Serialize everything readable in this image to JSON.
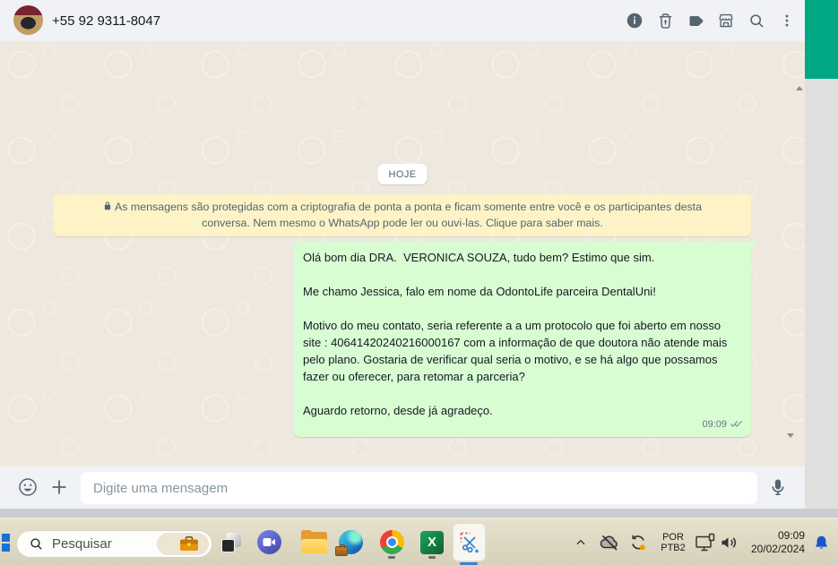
{
  "header": {
    "phone": "+55 92 9311-8047",
    "action_icons": [
      "info",
      "delete",
      "label",
      "storefront",
      "search",
      "more-options"
    ]
  },
  "chat": {
    "date_badge": "HOJE",
    "encryption_notice": "As mensagens são protegidas com a criptografia de ponta a ponta e ficam somente entre você e os participantes desta conversa. Nem mesmo o WhatsApp pode ler ou ouvi-las. Clique para saber mais.",
    "message": {
      "direction": "outgoing",
      "text": "Olá bom dia DRA.  VERONICA SOUZA, tudo bem? Estimo que sim.\n\nMe chamo Jessica, falo em nome da OdontoLife parceira DentalUni!\n\nMotivo do meu contato, seria referente a a um protocolo que foi aberto em nosso site : 40641420240216000167 com a informação de que doutora não atende mais pelo plano. Gostaria de verificar qual seria o motivo, e se há algo que possamos fazer ou oferecer, para retomar a parceria?\n\nAguardo retorno, desde já agradeço.",
      "time": "09:09",
      "status": "delivered-double-check"
    }
  },
  "composer": {
    "placeholder": "Digite uma mensagem",
    "icons": [
      "emoji",
      "attach-plus",
      "microphone"
    ]
  },
  "taskbar": {
    "search": {
      "placeholder": "Pesquisar",
      "badge_icon": "briefcase"
    },
    "pinned_apps": [
      "task-view",
      "chat",
      "file-explorer",
      "edge",
      "chrome",
      "excel",
      "snipping-tool"
    ],
    "tray": {
      "language_line1": "POR",
      "language_line2": "PTB2",
      "time": "09:09",
      "date": "20/02/2024",
      "icons": [
        "hidden-icons-chevron",
        "onedrive-offline",
        "sync-pending",
        "cast-display",
        "volume",
        "notification-bell"
      ]
    }
  },
  "colors": {
    "whatsapp_green": "#00a884",
    "bubble_green": "#d9fdd3",
    "banner_yellow": "#fdf3c7",
    "chat_background": "#efe8df",
    "bell_blue": "#1a56c9"
  }
}
